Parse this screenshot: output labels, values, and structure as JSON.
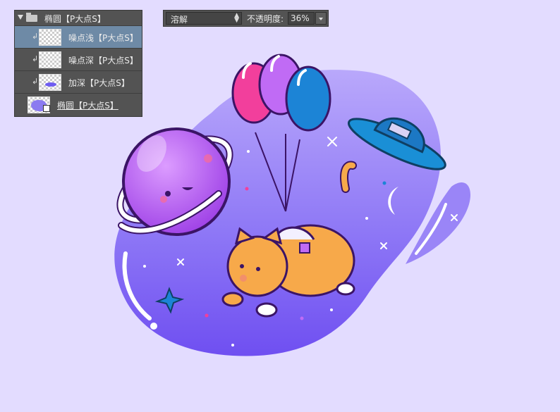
{
  "layers_panel": {
    "group": {
      "label": "椭圆【P大点S】"
    },
    "items": [
      {
        "label": "噪点浅【P大点S】",
        "selected": true
      },
      {
        "label": "噪点深【P大点S】",
        "selected": false
      },
      {
        "label": "加深【P大点S】",
        "selected": false
      }
    ],
    "shape_layer": {
      "label": "椭圆【P大点S】"
    }
  },
  "options_bar": {
    "blend_mode": "溶解",
    "opacity_label": "不透明度:",
    "opacity_value": "36%"
  },
  "colors": {
    "background": "#e3dcff",
    "blob": "#7d62f4",
    "planet": "#b45cf0",
    "balloon_pink": "#f23f9c",
    "balloon_purple": "#c06bf5",
    "balloon_blue": "#1c84d6",
    "ufo": "#1a8fd6",
    "cat": "#f7a94a"
  }
}
